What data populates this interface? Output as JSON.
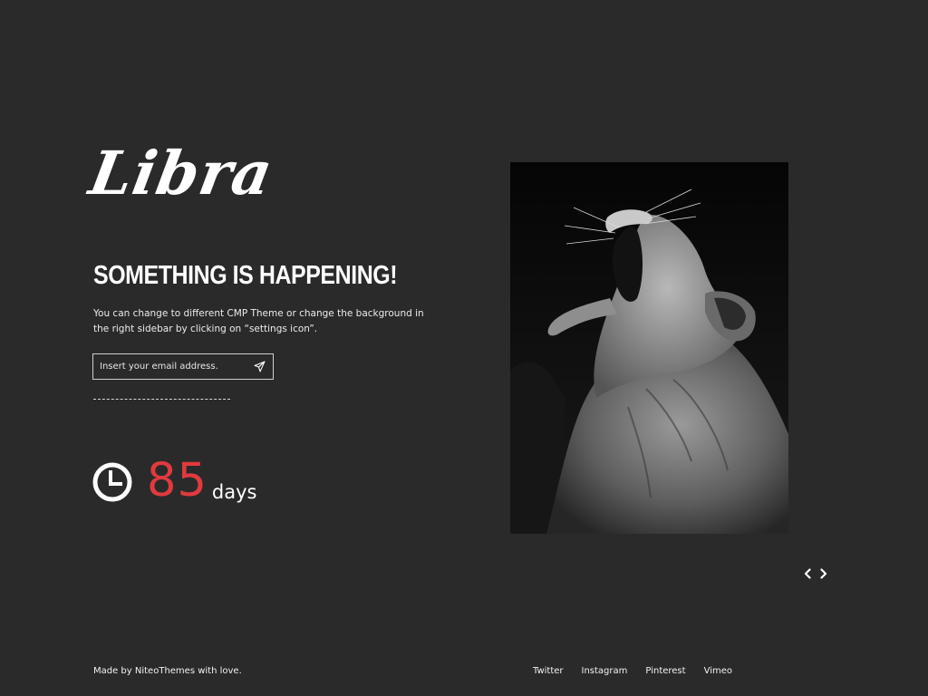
{
  "brand": {
    "logo_text": "Libra"
  },
  "hero": {
    "headline": "SOMETHING IS HAPPENING!",
    "description": "You can change to different CMP Theme or change the background in the right sidebar by clicking on “settings icon”."
  },
  "subscribe": {
    "placeholder": "Insert your email address.",
    "value": "",
    "submit_icon": "paper-plane-icon"
  },
  "countdown": {
    "icon": "clock-icon",
    "value": "85",
    "unit": "days"
  },
  "gallery": {
    "image_subject": "lioness-photo",
    "prev_icon": "chevron-left-icon",
    "next_icon": "chevron-right-icon"
  },
  "footer": {
    "credit": "Made by NiteoThemes with love.",
    "social": [
      {
        "label": "Twitter"
      },
      {
        "label": "Instagram"
      },
      {
        "label": "Pinterest"
      },
      {
        "label": "Vimeo"
      }
    ]
  },
  "colors": {
    "background": "#2a2a2b",
    "accent": "#e13a3e",
    "text": "#ffffff"
  }
}
